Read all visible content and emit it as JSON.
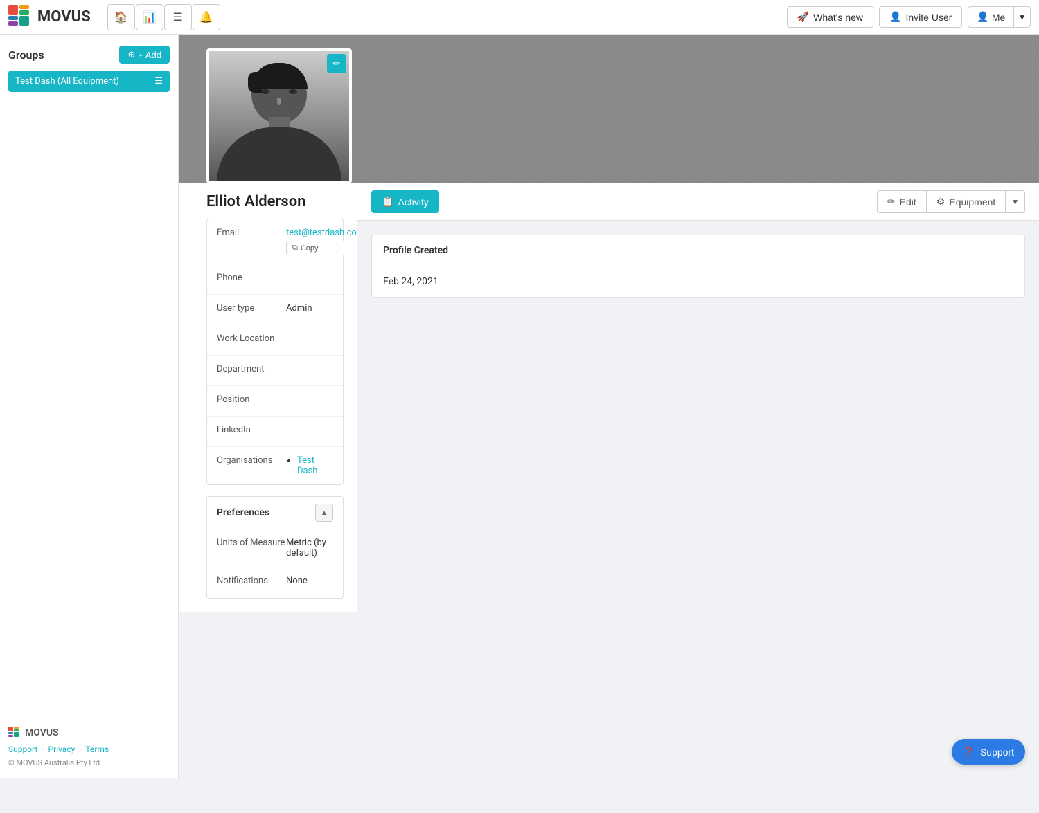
{
  "app": {
    "logo_text": "MOVUS"
  },
  "topnav": {
    "whats_new": "What's new",
    "invite_user": "Invite User",
    "me": "Me"
  },
  "sidebar": {
    "groups_title": "Groups",
    "add_label": "+ Add",
    "group_item": "Test Dash (All Equipment)",
    "footer_logo": "MOVUS",
    "support_link": "Support",
    "privacy_link": "Privacy",
    "terms_link": "Terms",
    "dot1": "·",
    "dot2": "·",
    "copyright": "© MOVUS Australia Pty Ltd."
  },
  "profile": {
    "name": "Elliot Alderson",
    "edit_icon": "✏",
    "email_label": "Email",
    "email_value": "test@testdash.com",
    "copy_label": "Copy",
    "phone_label": "Phone",
    "phone_value": "",
    "user_type_label": "User type",
    "user_type_value": "Admin",
    "work_location_label": "Work Location",
    "work_location_value": "",
    "department_label": "Department",
    "department_value": "",
    "position_label": "Position",
    "position_value": "",
    "linkedin_label": "LinkedIn",
    "linkedin_value": "",
    "organisations_label": "Organisations",
    "org_item": "Test Dash",
    "preferences_title": "Preferences",
    "units_label": "Units of Measure",
    "units_value": "Metric (by default)",
    "notifications_label": "Notifications",
    "notifications_value": "None"
  },
  "tabs": {
    "activity_label": "Activity",
    "edit_label": "Edit",
    "equipment_label": "Equipment"
  },
  "activity": {
    "card_header": "Profile Created",
    "card_date": "Feb 24, 2021"
  },
  "support": {
    "label": "Support"
  }
}
